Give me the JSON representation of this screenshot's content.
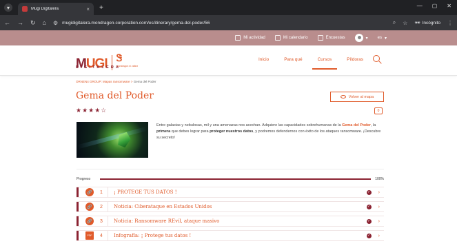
{
  "browser": {
    "tab_title": "Mugi Digitalera",
    "tab_close": "×",
    "new_tab": "+",
    "url": "mugidigitalera.mondragon-corporation.com/es/itinerary/gema-del-poder/56",
    "incognito_label": "Incógnito"
  },
  "topbar": {
    "activity": "Mi actividad",
    "calendar": "Mi calendario",
    "surveys": "Encuestas",
    "lang": "es"
  },
  "nav": {
    "logo_mugi": "MUGI",
    "logo_sub": "DIGITALERA",
    "logo_tag": "mondragon ni zaitez",
    "items": [
      "Inicio",
      "Para qué",
      "Cursos",
      "Píldoras"
    ],
    "active_index": 2
  },
  "breadcrumb": {
    "parent": "ORNEN4 GROUP: Mapas ransomware",
    "sep": ">",
    "current": "Gema del Poder"
  },
  "page": {
    "title": "Gema del Poder",
    "back_button": "Volver al mapa",
    "stars": "★★★★☆",
    "rating": 4,
    "description": {
      "p1": "Entre galaxias y nebulosas, mil y una amenazas nos acechan. Adquiere las capacidades sobrehumanas de la ",
      "b1": "Gema del Poder",
      "p2": ", la ",
      "b2": "primera",
      "p3": " que debes lograr para ",
      "b3": "proteger nuestros datos",
      "p4": ", y podremos defendernos con éxito de los ataques ransomware. ¡Descubre su secreto!"
    },
    "progress_label": "Progreso",
    "progress_value": "100%",
    "progress_fraction": 1.0
  },
  "items": [
    {
      "num": "1",
      "icon": "link-icon",
      "name": "¡ PROTEGE TUS DATOS !"
    },
    {
      "num": "2",
      "icon": "link-icon",
      "name": "Noticia: Ciberataque en Estados Unidos"
    },
    {
      "num": "3",
      "icon": "link-icon",
      "name": "Noticia: Ransomware REvil, ataque masivo"
    },
    {
      "num": "4",
      "icon": "pdf-icon",
      "name": "Infografía: ¡ Protege tus datos !"
    }
  ],
  "colors": {
    "accent": "#e05a2a",
    "brand": "#8b2332",
    "topbar": "#b98d8d"
  }
}
